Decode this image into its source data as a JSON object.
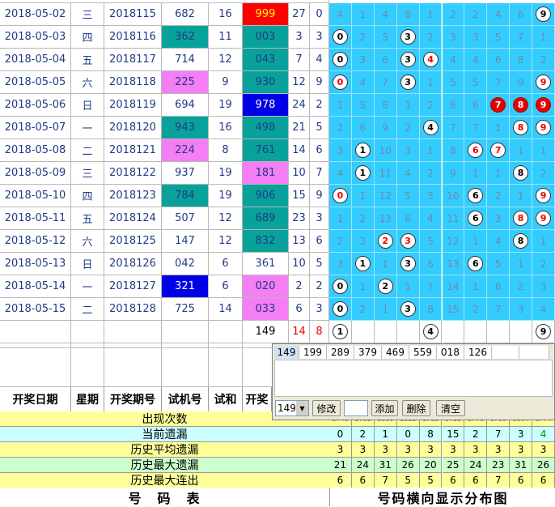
{
  "rows": [
    {
      "date": "2018-05-02",
      "week": "三",
      "issue": "2018115",
      "test": "682",
      "sum": "16",
      "win": "999",
      "ws": "27",
      "wk": "0",
      "win_style": "red",
      "test_style": "",
      "dist": [
        "4",
        "1",
        "4",
        "8",
        "1",
        "2",
        "2",
        "4",
        "6",
        "9"
      ],
      "hits": [
        9
      ]
    },
    {
      "date": "2018-05-03",
      "week": "四",
      "issue": "2018116",
      "test": "362",
      "sum": "11",
      "win": "003",
      "ws": "3",
      "wk": "3",
      "win_style": "teal",
      "test_style": "teal",
      "dist": [
        "0",
        "2",
        "5",
        "3",
        "2",
        "3",
        "3",
        "5",
        "7",
        "1"
      ],
      "hits": [
        0,
        3
      ]
    },
    {
      "date": "2018-05-04",
      "week": "五",
      "issue": "2018117",
      "test": "714",
      "sum": "12",
      "win": "043",
      "ws": "7",
      "wk": "4",
      "win_style": "teal",
      "test_style": "",
      "dist": [
        "0",
        "3",
        "6",
        "3",
        "4",
        "4",
        "4",
        "6",
        "8",
        "2"
      ],
      "hits": [
        0,
        3,
        4
      ]
    },
    {
      "date": "2018-05-05",
      "week": "六",
      "issue": "2018118",
      "test": "225",
      "sum": "9",
      "win": "930",
      "ws": "12",
      "wk": "9",
      "win_style": "teal",
      "test_style": "pink",
      "dist": [
        "0",
        "4",
        "7",
        "3",
        "1",
        "5",
        "5",
        "7",
        "9",
        "9"
      ],
      "hits": [
        0,
        3,
        9
      ]
    },
    {
      "date": "2018-05-06",
      "week": "日",
      "issue": "2018119",
      "test": "694",
      "sum": "19",
      "win": "978",
      "ws": "24",
      "wk": "2",
      "win_style": "blue",
      "test_style": "",
      "dist": [
        "1",
        "5",
        "8",
        "1",
        "2",
        "6",
        "6",
        "7",
        "8",
        "9"
      ],
      "hits": [
        7,
        8,
        9
      ]
    },
    {
      "date": "2018-05-07",
      "week": "一",
      "issue": "2018120",
      "test": "943",
      "sum": "16",
      "win": "498",
      "ws": "21",
      "wk": "5",
      "win_style": "teal",
      "test_style": "teal",
      "dist": [
        "2",
        "6",
        "9",
        "2",
        "4",
        "7",
        "7",
        "1",
        "8",
        "9"
      ],
      "hits": [
        4,
        8,
        9
      ]
    },
    {
      "date": "2018-05-08",
      "week": "二",
      "issue": "2018121",
      "test": "224",
      "sum": "8",
      "win": "761",
      "ws": "14",
      "wk": "6",
      "win_style": "teal",
      "test_style": "pink",
      "dist": [
        "3",
        "1",
        "10",
        "3",
        "1",
        "8",
        "6",
        "7",
        "1",
        "1"
      ],
      "hits": [
        1,
        6,
        7
      ]
    },
    {
      "date": "2018-05-09",
      "week": "三",
      "issue": "2018122",
      "test": "937",
      "sum": "19",
      "win": "181",
      "ws": "10",
      "wk": "7",
      "win_style": "pink",
      "test_style": "",
      "dist": [
        "4",
        "1",
        "11",
        "4",
        "2",
        "9",
        "1",
        "1",
        "8",
        "2"
      ],
      "hits": [
        1,
        8
      ]
    },
    {
      "date": "2018-05-10",
      "week": "四",
      "issue": "2018123",
      "test": "784",
      "sum": "19",
      "win": "906",
      "ws": "15",
      "wk": "9",
      "win_style": "teal",
      "test_style": "teal",
      "dist": [
        "0",
        "1",
        "12",
        "5",
        "3",
        "10",
        "6",
        "2",
        "1",
        "9"
      ],
      "hits": [
        0,
        6,
        9
      ]
    },
    {
      "date": "2018-05-11",
      "week": "五",
      "issue": "2018124",
      "test": "507",
      "sum": "12",
      "win": "689",
      "ws": "23",
      "wk": "3",
      "win_style": "teal",
      "test_style": "",
      "dist": [
        "1",
        "2",
        "13",
        "6",
        "4",
        "11",
        "6",
        "3",
        "8",
        "9"
      ],
      "hits": [
        6,
        8,
        9
      ]
    },
    {
      "date": "2018-05-12",
      "week": "六",
      "issue": "2018125",
      "test": "147",
      "sum": "12",
      "win": "832",
      "ws": "13",
      "wk": "6",
      "win_style": "teal",
      "test_style": "",
      "dist": [
        "2",
        "3",
        "2",
        "3",
        "5",
        "12",
        "1",
        "4",
        "8",
        "1"
      ],
      "hits": [
        2,
        3,
        8
      ]
    },
    {
      "date": "2018-05-13",
      "week": "日",
      "issue": "2018126",
      "test": "042",
      "sum": "6",
      "win": "361",
      "ws": "10",
      "wk": "5",
      "win_style": "",
      "test_style": "",
      "dist": [
        "3",
        "1",
        "1",
        "3",
        "6",
        "13",
        "6",
        "5",
        "1",
        "2"
      ],
      "hits": [
        1,
        3,
        6
      ]
    },
    {
      "date": "2018-05-14",
      "week": "一",
      "issue": "2018127",
      "test": "321",
      "sum": "6",
      "win": "020",
      "ws": "2",
      "wk": "2",
      "win_style": "pink",
      "test_style": "blue",
      "dist": [
        "0",
        "1",
        "2",
        "1",
        "7",
        "14",
        "1",
        "6",
        "2",
        "3"
      ],
      "hits": [
        0,
        2
      ]
    },
    {
      "date": "2018-05-15",
      "week": "二",
      "issue": "2018128",
      "test": "725",
      "sum": "14",
      "win": "033",
      "ws": "6",
      "wk": "3",
      "win_style": "pink",
      "test_style": "",
      "dist": [
        "0",
        "2",
        "1",
        "3",
        "8",
        "15",
        "2",
        "7",
        "3",
        "4"
      ],
      "hits": [
        0,
        3
      ]
    }
  ],
  "summary_row": {
    "win": "149",
    "ws": "14",
    "wk": "8",
    "hits": [
      "1",
      "",
      "",
      "",
      "4",
      "",
      "",
      "",
      "",
      "9"
    ]
  },
  "headers": {
    "date": "开奖日期",
    "week": "星期",
    "issue": "开奖期号",
    "test": "试机号",
    "sum": "试和",
    "win": "开奖"
  },
  "panel": {
    "numbers": [
      "149",
      "199",
      "289",
      "379",
      "469",
      "559",
      "018",
      "126",
      "",
      ""
    ],
    "select_value": "149",
    "modify_label": "修改",
    "add_label": "添加",
    "delete_label": "删除",
    "clear_label": "清空"
  },
  "stats": [
    {
      "label": "出现次数",
      "values": [
        "1740",
        "1761",
        "1660",
        "1616",
        "1762",
        "1755",
        "1770",
        "1739",
        "1804",
        "1774"
      ],
      "style": "ylw"
    },
    {
      "label": "当前遗漏",
      "values": [
        "0",
        "2",
        "1",
        "0",
        "8",
        "15",
        "2",
        "7",
        "3",
        "4"
      ],
      "style": "lcy"
    },
    {
      "label": "历史平均遗漏",
      "values": [
        "3",
        "3",
        "3",
        "3",
        "3",
        "3",
        "3",
        "3",
        "3",
        "3"
      ],
      "style": "ylw"
    },
    {
      "label": "历史最大遗漏",
      "values": [
        "21",
        "24",
        "31",
        "26",
        "20",
        "25",
        "24",
        "23",
        "31",
        "26"
      ],
      "style": "lgrn"
    },
    {
      "label": "历史最大连出",
      "values": [
        "6",
        "6",
        "7",
        "5",
        "5",
        "6",
        "6",
        "7",
        "6",
        "6"
      ],
      "style": "ylw"
    }
  ],
  "bottom": {
    "left_title": "号　码　表",
    "right_title": "号码横向显示分布图"
  }
}
